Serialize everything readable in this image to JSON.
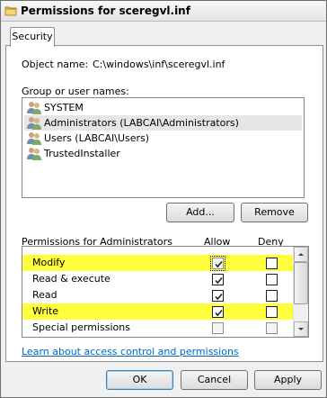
{
  "window": {
    "title": "Permissions for sceregvl.inf",
    "icon": "folder-icon"
  },
  "tabs": [
    {
      "label": "Security",
      "selected": true
    }
  ],
  "object": {
    "label": "Object name:",
    "value": "C:\\windows\\inf\\sceregvl.inf"
  },
  "groups": {
    "label": "Group or user names:",
    "items": [
      {
        "name": "SYSTEM",
        "icon": "users-icon",
        "selected": false
      },
      {
        "name": "Administrators (LABCAI\\Administrators)",
        "icon": "users-icon",
        "selected": true
      },
      {
        "name": "Users (LABCAI\\Users)",
        "icon": "users-icon",
        "selected": false
      },
      {
        "name": "TrustedInstaller",
        "icon": "users-icon",
        "selected": false
      }
    ]
  },
  "buttons": {
    "add": "Add...",
    "remove": "Remove",
    "ok": "OK",
    "cancel": "Cancel",
    "apply": "Apply"
  },
  "permissions": {
    "label": "Permissions for Administrators",
    "allow_header": "Allow",
    "deny_header": "Deny",
    "highlight_color": "#ffff3c",
    "rows": [
      {
        "name": "Modify",
        "allow": true,
        "deny": false,
        "highlighted": true
      },
      {
        "name": "Read & execute",
        "allow": true,
        "deny": false,
        "highlighted": false
      },
      {
        "name": "Read",
        "allow": true,
        "deny": false,
        "highlighted": false
      },
      {
        "name": "Write",
        "allow": true,
        "deny": false,
        "highlighted": true
      },
      {
        "name": "Special permissions",
        "allow": false,
        "deny": false,
        "highlighted": false
      }
    ]
  },
  "link": {
    "text": "Learn about access control and permissions",
    "color": "#0066cc"
  }
}
